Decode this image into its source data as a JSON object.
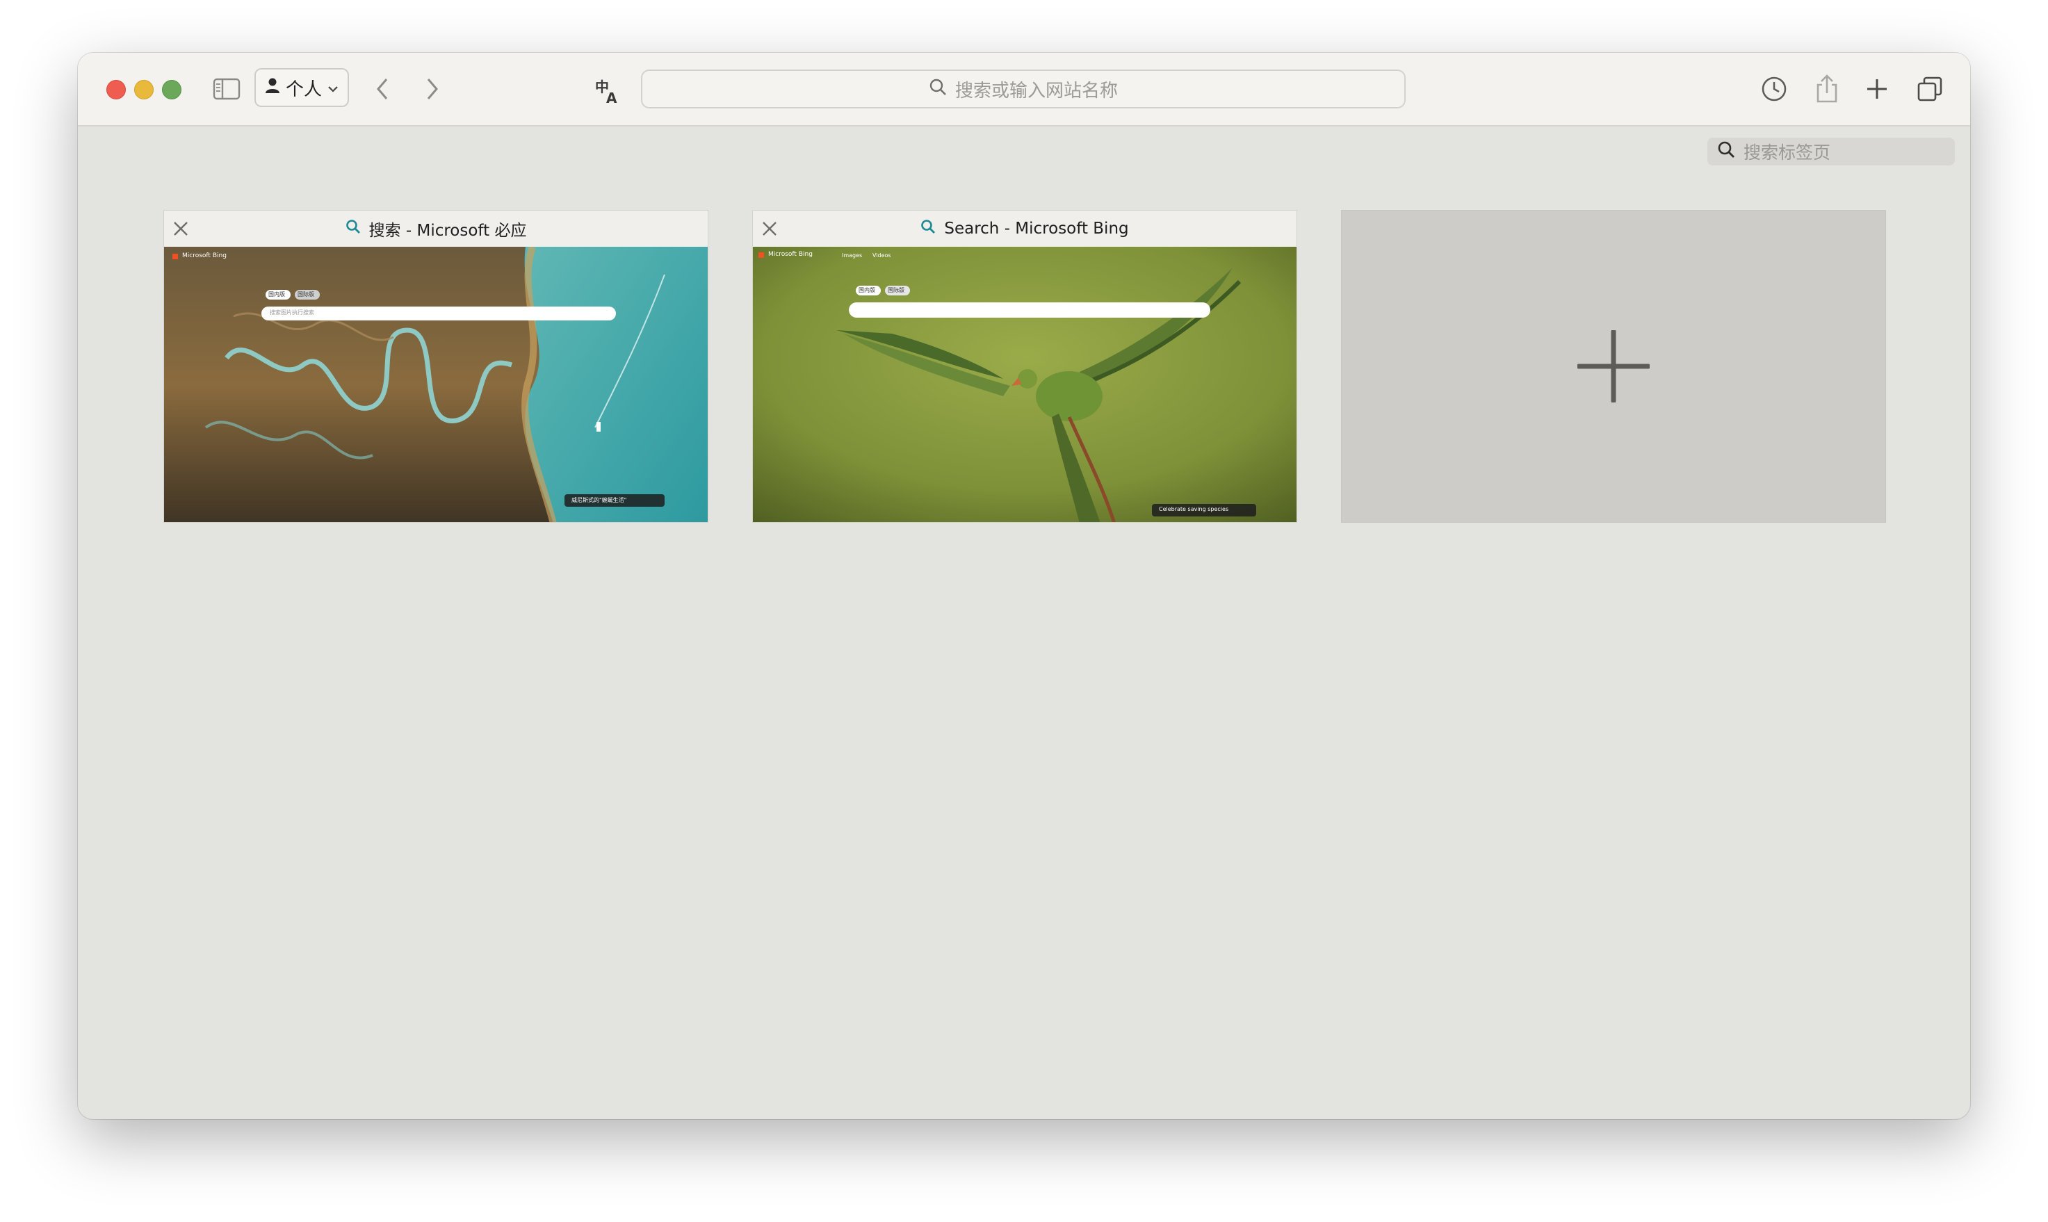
{
  "browser": {
    "profile_label": "个人",
    "address_placeholder": "搜索或输入网站名称",
    "tab_search_placeholder": "搜索标签页"
  },
  "tabs": [
    {
      "title": "搜索 - Microsoft 必应",
      "thumb_brand": "Microsoft Bing",
      "thumb_pill_1": "国内版",
      "thumb_pill_2": "国际版",
      "thumb_search_hint": "搜索图片执行搜索",
      "thumb_caption": "威尼斯式的\"蜿蜒生活\""
    },
    {
      "title": "Search - Microsoft Bing",
      "thumb_brand": "Microsoft Bing",
      "thumb_nav_1": "Images",
      "thumb_nav_2": "Videos",
      "thumb_pill_1": "国内版",
      "thumb_pill_2": "国际版",
      "thumb_caption": "Celebrate saving species"
    }
  ],
  "icons": {
    "sidebar": "sidebar-icon",
    "back": "chevron-left-icon",
    "forward": "chevron-right-icon",
    "translate": "translate-icon",
    "history": "clock-icon",
    "share": "share-icon",
    "new_tab": "plus-icon",
    "tab_overview": "tab-overview-icon"
  }
}
